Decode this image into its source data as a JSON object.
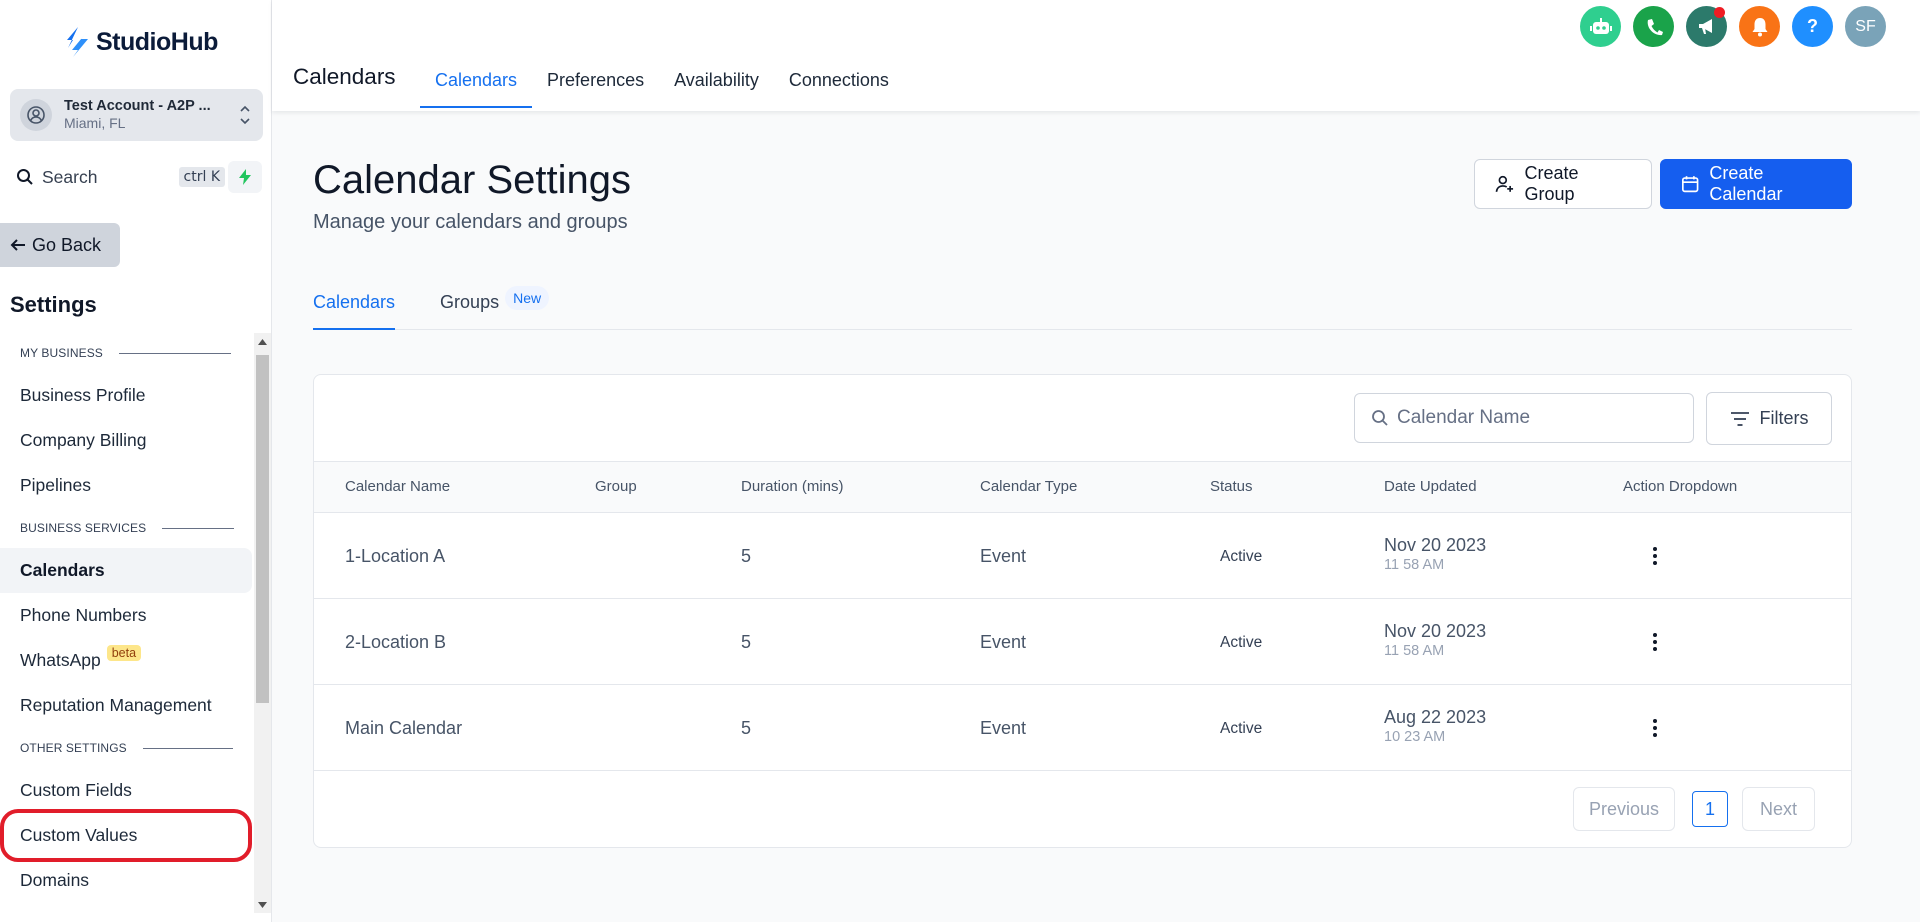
{
  "brand": {
    "name": "StudioHub",
    "accent": "#155eef"
  },
  "account": {
    "name": "Test Account - A2P ...",
    "location": "Miami, FL"
  },
  "sidebar_search": {
    "label": "Search",
    "shortcut": "ctrl K"
  },
  "go_back": "Go Back",
  "settings_title": "Settings",
  "nav": {
    "sections": {
      "my_business": "MY BUSINESS",
      "business_services": "BUSINESS SERVICES",
      "other_settings": "OTHER SETTINGS"
    },
    "items": {
      "business_profile": "Business Profile",
      "company_billing": "Company Billing",
      "pipelines": "Pipelines",
      "calendars": "Calendars",
      "phone_numbers": "Phone Numbers",
      "whatsapp": "WhatsApp",
      "whatsapp_badge": "beta",
      "reputation": "Reputation Management",
      "custom_fields": "Custom Fields",
      "custom_values": "Custom Values",
      "domains": "Domains"
    },
    "active": "Calendars",
    "highlighted": "Custom Values"
  },
  "header": {
    "title": "Calendars",
    "tabs": [
      "Calendars",
      "Preferences",
      "Availability",
      "Connections"
    ],
    "active_tab": "Calendars",
    "icons": [
      {
        "name": "ai-bot-icon",
        "color": "#2fcf8f"
      },
      {
        "name": "phone-icon",
        "color": "#1aa34a"
      },
      {
        "name": "megaphone-icon",
        "color": "#2c7a6b"
      },
      {
        "name": "bell-icon",
        "color": "#f97316"
      },
      {
        "name": "help-icon",
        "color": "#1f8fff"
      }
    ],
    "avatar_initials": "SF",
    "avatar_color": "#7aa3b8"
  },
  "page": {
    "title": "Calendar Settings",
    "subtitle": "Manage your calendars and groups",
    "create_group": "Create Group",
    "create_calendar": "Create Calendar"
  },
  "subtabs": {
    "calendars": "Calendars",
    "groups": "Groups",
    "groups_badge": "New"
  },
  "table": {
    "search_placeholder": "Calendar Name",
    "filters_label": "Filters",
    "columns": [
      "Calendar Name",
      "Group",
      "Duration (mins)",
      "Calendar Type",
      "Status",
      "Date Updated",
      "Action Dropdown"
    ],
    "rows": [
      {
        "name": "1-Location A",
        "group": "",
        "duration": "5",
        "type": "Event",
        "status": "Active",
        "date": "Nov 20 2023",
        "time": "11 58 AM"
      },
      {
        "name": "2-Location B",
        "group": "",
        "duration": "5",
        "type": "Event",
        "status": "Active",
        "date": "Nov 20 2023",
        "time": "11 58 AM"
      },
      {
        "name": "Main Calendar",
        "group": "",
        "duration": "5",
        "type": "Event",
        "status": "Active",
        "date": "Aug 22 2023",
        "time": "10 23 AM"
      }
    ],
    "pagination": {
      "previous": "Previous",
      "current_page": "1",
      "next": "Next"
    }
  }
}
